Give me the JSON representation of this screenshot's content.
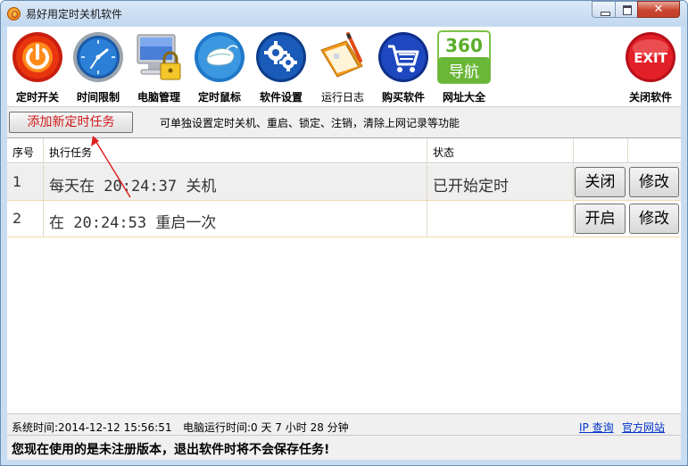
{
  "window": {
    "title": "易好用定时关机软件",
    "close_glyph": "✕"
  },
  "toolbar": [
    {
      "label": "定时开关",
      "icon": "power-icon"
    },
    {
      "label": "时间限制",
      "icon": "clock-icon"
    },
    {
      "label": "电脑管理",
      "icon": "computer-lock-icon"
    },
    {
      "label": "定时鼠标",
      "icon": "mouse-icon"
    },
    {
      "label": "软件设置",
      "icon": "gear-icon"
    },
    {
      "label": "运行日志",
      "icon": "log-book-icon"
    },
    {
      "label": "购买软件",
      "icon": "cart-icon"
    },
    {
      "label": "网址大全",
      "icon": "360-nav-icon",
      "badge_top": "360",
      "badge_bottom": "导航"
    },
    {
      "label": "关闭软件",
      "icon": "exit-icon",
      "badge": "EXIT"
    }
  ],
  "action": {
    "add_button": "添加新定时任务",
    "hint": "可单独设置定时关机、重启、锁定、注销，清除上网记录等功能"
  },
  "table": {
    "headers": [
      "序号",
      "执行任务",
      "状态"
    ],
    "rows": [
      {
        "index": "1",
        "task": "每天在 20:24:37 关机",
        "status": "已开始定时",
        "toggle": "关闭",
        "edit": "修改"
      },
      {
        "index": "2",
        "task": "在 20:24:53 重启一次",
        "status": "",
        "toggle": "开启",
        "edit": "修改"
      }
    ]
  },
  "status": {
    "system_time": "系统时间:2014-12-12 15:56:51",
    "uptime": "电脑运行时间:0 天 7 小时 28 分钟",
    "ip_link": "IP 查询",
    "site_link": "官方网站"
  },
  "notice": "您现在使用的是未注册版本，退出软件时将不会保存任务!",
  "colors": {
    "accent_red": "#d01818",
    "link_blue": "#0033cc",
    "title_bar": "#c8ddf2"
  }
}
